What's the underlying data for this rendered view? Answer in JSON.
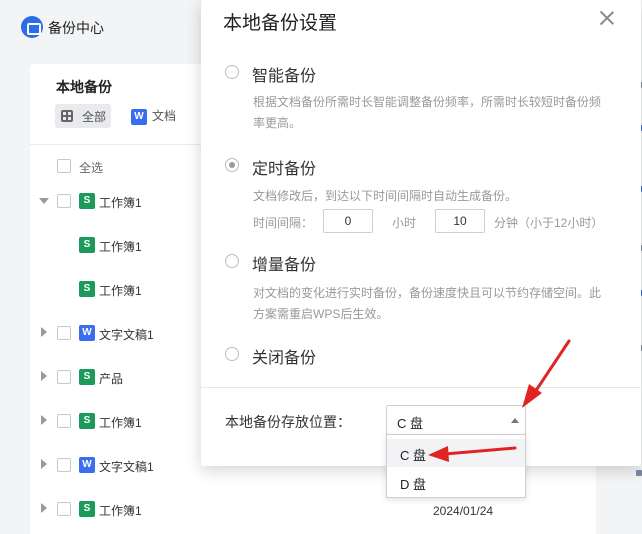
{
  "app": {
    "title": "备份中心"
  },
  "panel": {
    "title": "本地备份",
    "filters": [
      {
        "label": "全部",
        "active": true
      },
      {
        "label": "文档",
        "badge": "W"
      }
    ],
    "select_all": "全选",
    "rows": [
      {
        "badge": "S",
        "name": "工作簿1",
        "expanded": true,
        "indent": 0
      },
      {
        "badge": "S",
        "name": "工作簿1",
        "indent": 1
      },
      {
        "badge": "S",
        "name": "工作簿1",
        "indent": 1
      },
      {
        "badge": "W",
        "name": "文字文稿1",
        "indent": 0
      },
      {
        "badge": "S",
        "name": "产品",
        "indent": 0
      },
      {
        "badge": "S",
        "name": "工作簿1",
        "indent": 0
      },
      {
        "badge": "W",
        "name": "文字文稿1",
        "indent": 0
      },
      {
        "badge": "S",
        "name": "工作簿1",
        "indent": 0
      }
    ],
    "last_date": "2024/01/24"
  },
  "modal": {
    "title": "本地备份设置",
    "options": [
      {
        "label": "智能备份",
        "checked": false,
        "desc": "根据文档备份所需时长智能调整备份频率，所需时长较短时备份频率更高。"
      },
      {
        "label": "定时备份",
        "checked": true,
        "desc": "文档修改后，到达以下时间间隔时自动生成备份。"
      },
      {
        "label": "增量备份",
        "checked": false,
        "desc": "对文档的变化进行实时备份，备份速度快且可以节约存储空间。此方案需重启WPS后生效。"
      },
      {
        "label": "关闭备份",
        "checked": false,
        "desc": ""
      }
    ],
    "interval": {
      "label": "时间间隔：",
      "hours": "0",
      "hours_unit": "小时",
      "minutes": "10",
      "minutes_unit": "分钟（小于12小时）"
    },
    "location": {
      "label": "本地备份存放位置：",
      "selected": "C 盘",
      "options": [
        "C 盘",
        "D 盘"
      ]
    }
  },
  "colors": {
    "accent": "#2b6de8",
    "sheet_badge": "#1b9a59",
    "doc_badge": "#3a6df0",
    "annotation_arrow": "#e02424"
  }
}
